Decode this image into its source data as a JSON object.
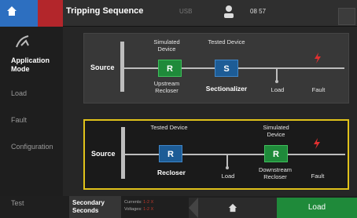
{
  "header": {
    "title": "Tripping Sequence",
    "usb": "USB",
    "time": "08 57"
  },
  "sidebar": {
    "items": [
      {
        "label": "Application Mode",
        "active": true
      },
      {
        "label": "Load"
      },
      {
        "label": "Fault"
      },
      {
        "label": "Configuration"
      },
      {
        "label": "Test"
      }
    ]
  },
  "panel1": {
    "source": "Source",
    "device1": {
      "top": "Simulated Device",
      "box": "R",
      "bottom": "Upstream Recloser"
    },
    "device2": {
      "top": "Tested Device",
      "box": "S",
      "bottom": "Sectionalizer"
    },
    "load": "Load",
    "fault": "Fault"
  },
  "panel2": {
    "source": "Source",
    "device1": {
      "top": "Tested Device",
      "box": "R",
      "bottom": "Recloser"
    },
    "load": "Load",
    "device2": {
      "top": "Simulated Device",
      "box": "R",
      "bottom": "Downstream Recloser"
    },
    "fault": "Fault"
  },
  "bottom": {
    "secondary": "Secondary Seconds",
    "currents_label": "Currents:",
    "currents_value": "1-2 X",
    "voltages_label": "Voltages:",
    "voltages_value": "1-2 X",
    "load_button": "Load"
  },
  "colors": {
    "accent_blue": "#2d6fc0",
    "accent_red": "#b3262b",
    "recloser_green": "#1f8a3a",
    "device_blue": "#1d5c96",
    "highlight_yellow": "#e0c21a"
  }
}
